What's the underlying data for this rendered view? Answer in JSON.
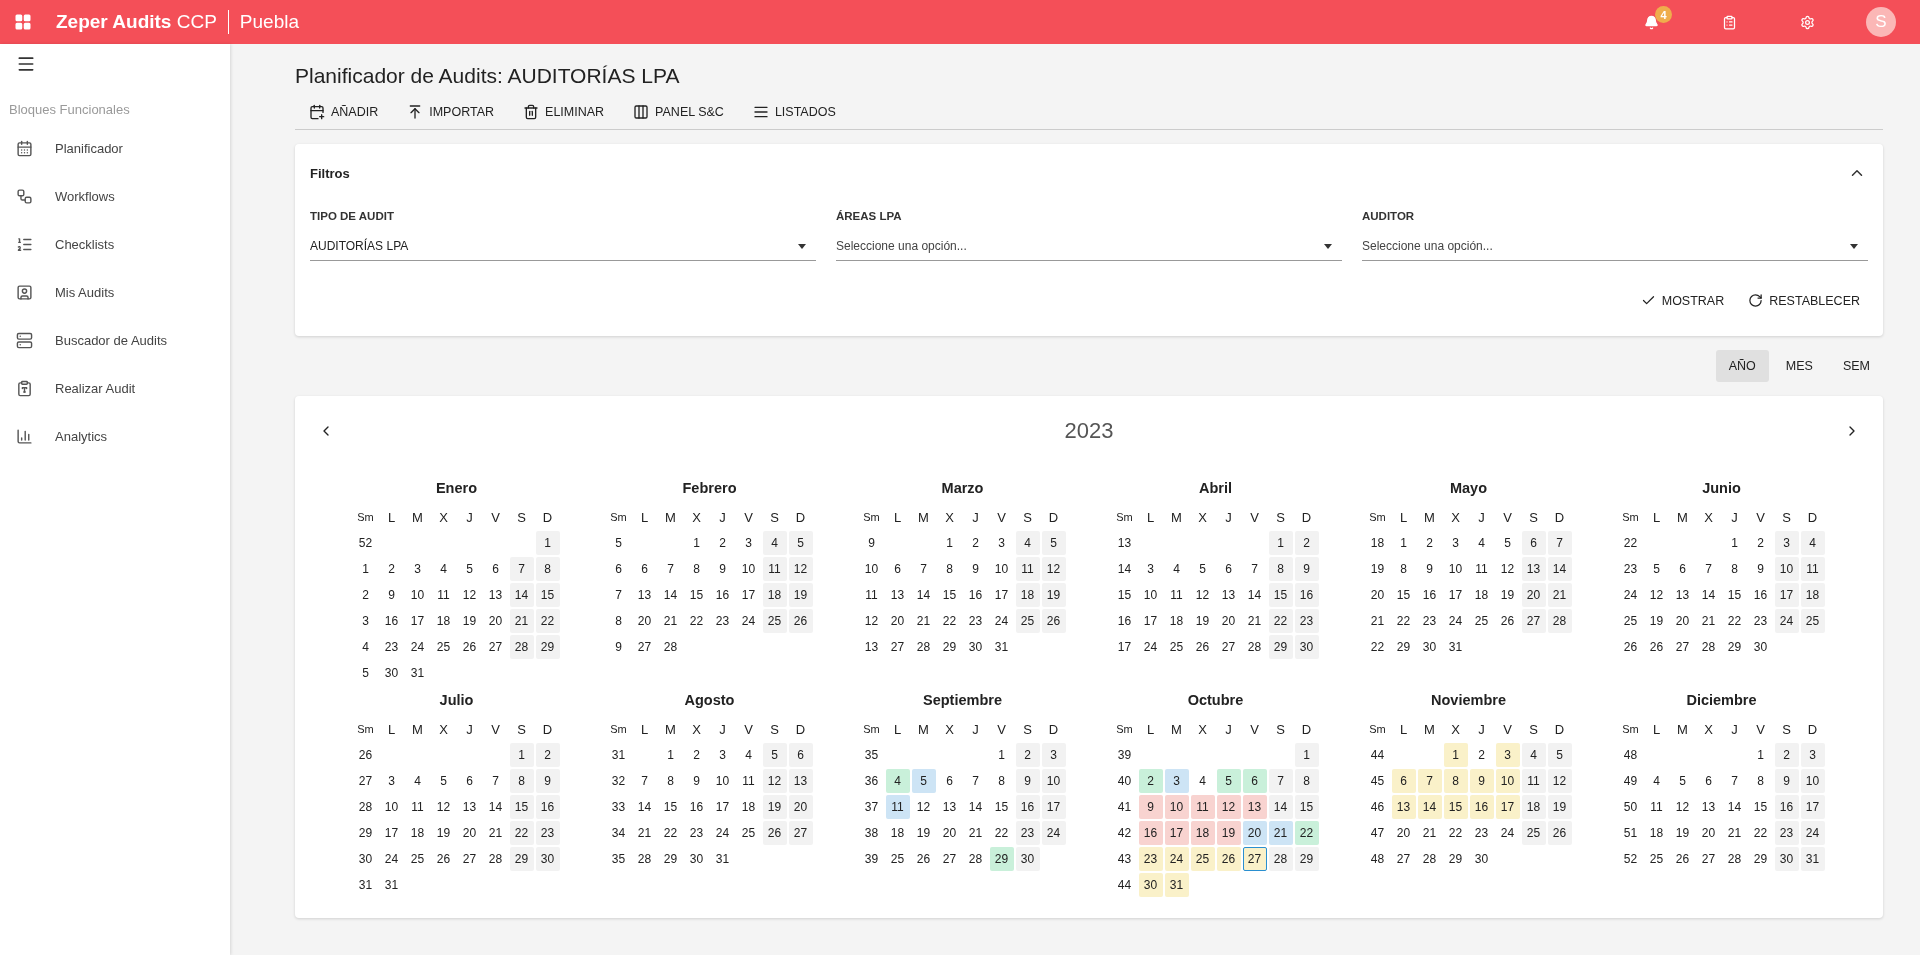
{
  "topbar": {
    "brand_bold": "Zeper Audits",
    "brand_light": "CCP",
    "site": "Puebla",
    "notifications": "4",
    "avatar": "S"
  },
  "sidebar": {
    "section": "Bloques Funcionales",
    "items": [
      {
        "label": "Planificador",
        "kind": "calendar"
      },
      {
        "label": "Workflows",
        "kind": "workflow"
      },
      {
        "label": "Checklists",
        "kind": "checklist"
      },
      {
        "label": "Mis Audits",
        "kind": "user"
      },
      {
        "label": "Buscador de Audits",
        "kind": "stack"
      },
      {
        "label": "Realizar Audit",
        "kind": "clipboard"
      },
      {
        "label": "Analytics",
        "kind": "chart"
      }
    ]
  },
  "page": {
    "title": "Planificador de Audits: AUDITORÍAS LPA",
    "actions": [
      {
        "label": "AÑADIR",
        "kind": "add"
      },
      {
        "label": "IMPORTAR",
        "kind": "import"
      },
      {
        "label": "ELIMINAR",
        "kind": "delete"
      },
      {
        "label": "PANEL S&C",
        "kind": "panel"
      },
      {
        "label": "LISTADOS",
        "kind": "list"
      }
    ]
  },
  "filters": {
    "title": "Filtros",
    "expanded": true,
    "fields": [
      {
        "label": "TIPO DE AUDIT",
        "value": "AUDITORÍAS LPA"
      },
      {
        "label": "ÁREAS LPA",
        "placeholder": "Seleccione una opción..."
      },
      {
        "label": "AUDITOR",
        "placeholder": "Seleccione una opción..."
      }
    ],
    "buttons": [
      {
        "label": "MOSTRAR",
        "kind": "show"
      },
      {
        "label": "RESTABLECER",
        "kind": "reset"
      }
    ]
  },
  "views": [
    {
      "label": "AÑO",
      "selected": true
    },
    {
      "label": "MES",
      "selected": false
    },
    {
      "label": "SEM",
      "selected": false
    }
  ],
  "calendar": {
    "year": "2023",
    "months": [
      {
        "name": "Enero",
        "weekdays": [
          "Sm",
          "L",
          "M",
          "X",
          "J",
          "V",
          "S",
          "D"
        ],
        "weeks": [
          {
            "week": "52",
            "starts_midweek": true,
            "days": [
              "1"
            ]
          },
          {
            "week": "1",
            "days": [
              "2",
              "3",
              "4",
              "5",
              "6",
              "7",
              "8"
            ]
          },
          {
            "week": "2",
            "days": [
              "9",
              "10",
              "11",
              "12",
              "13",
              "14",
              "15"
            ]
          },
          {
            "week": "3",
            "days": [
              "16",
              "17",
              "18",
              "19",
              "20",
              "21",
              "22"
            ]
          },
          {
            "week": "4",
            "days": [
              "23",
              "24",
              "25",
              "26",
              "27",
              "28",
              "29"
            ]
          },
          {
            "week": "5",
            "days": [
              "30",
              "31"
            ]
          }
        ]
      },
      {
        "name": "Febrero",
        "weekdays": [
          "Sm",
          "L",
          "M",
          "X",
          "J",
          "V",
          "S",
          "D"
        ],
        "weeks": [
          {
            "week": "5",
            "starts_midweek": true,
            "days": [
              "1",
              "2",
              "3",
              "4",
              "5"
            ]
          },
          {
            "week": "6",
            "days": [
              "6",
              "7",
              "8",
              "9",
              "10",
              "11",
              "12"
            ]
          },
          {
            "week": "7",
            "days": [
              "13",
              "14",
              "15",
              "16",
              "17",
              "18",
              "19"
            ]
          },
          {
            "week": "8",
            "days": [
              "20",
              "21",
              "22",
              "23",
              "24",
              "25",
              "26"
            ]
          },
          {
            "week": "9",
            "days": [
              "27",
              "28"
            ]
          }
        ]
      },
      {
        "name": "Marzo",
        "weekdays": [
          "Sm",
          "L",
          "M",
          "X",
          "J",
          "V",
          "S",
          "D"
        ],
        "weeks": [
          {
            "week": "9",
            "starts_midweek": true,
            "days": [
              "1",
              "2",
              "3",
              "4",
              "5"
            ]
          },
          {
            "week": "10",
            "days": [
              "6",
              "7",
              "8",
              "9",
              "10",
              "11",
              "12"
            ]
          },
          {
            "week": "11",
            "days": [
              "13",
              "14",
              "15",
              "16",
              "17",
              "18",
              "19"
            ]
          },
          {
            "week": "12",
            "days": [
              "20",
              "21",
              "22",
              "23",
              "24",
              "25",
              "26"
            ]
          },
          {
            "week": "13",
            "days": [
              "27",
              "28",
              "29",
              "30",
              "31"
            ]
          }
        ]
      },
      {
        "name": "Abril",
        "weekdays": [
          "Sm",
          "L",
          "M",
          "X",
          "J",
          "V",
          "S",
          "D"
        ],
        "weeks": [
          {
            "week": "13",
            "starts_midweek": true,
            "days": [
              "1",
              "2"
            ]
          },
          {
            "week": "14",
            "days": [
              "3",
              "4",
              "5",
              "6",
              "7",
              "8",
              "9"
            ]
          },
          {
            "week": "15",
            "days": [
              "10",
              "11",
              "12",
              "13",
              "14",
              "15",
              "16"
            ]
          },
          {
            "week": "16",
            "days": [
              "17",
              "18",
              "19",
              "20",
              "21",
              "22",
              "23"
            ]
          },
          {
            "week": "17",
            "days": [
              "24",
              "25",
              "26",
              "27",
              "28",
              "29",
              "30"
            ]
          }
        ]
      },
      {
        "name": "Mayo",
        "weekdays": [
          "Sm",
          "L",
          "M",
          "X",
          "J",
          "V",
          "S",
          "D"
        ],
        "weeks": [
          {
            "week": "18",
            "days": [
              "1",
              "2",
              "3",
              "4",
              "5",
              "6",
              "7"
            ]
          },
          {
            "week": "19",
            "days": [
              "8",
              "9",
              "10",
              "11",
              "12",
              "13",
              "14"
            ]
          },
          {
            "week": "20",
            "days": [
              "15",
              "16",
              "17",
              "18",
              "19",
              "20",
              "21"
            ]
          },
          {
            "week": "21",
            "days": [
              "22",
              "23",
              "24",
              "25",
              "26",
              "27",
              "28"
            ]
          },
          {
            "week": "22",
            "days": [
              "29",
              "30",
              "31"
            ]
          }
        ]
      },
      {
        "name": "Junio",
        "weekdays": [
          "Sm",
          "L",
          "M",
          "X",
          "J",
          "V",
          "S",
          "D"
        ],
        "weeks": [
          {
            "week": "22",
            "starts_midweek": true,
            "days": [
              "1",
              "2",
              "3",
              "4"
            ]
          },
          {
            "week": "23",
            "days": [
              "5",
              "6",
              "7",
              "8",
              "9",
              "10",
              "11"
            ]
          },
          {
            "week": "24",
            "days": [
              "12",
              "13",
              "14",
              "15",
              "16",
              "17",
              "18"
            ]
          },
          {
            "week": "25",
            "days": [
              "19",
              "20",
              "21",
              "22",
              "23",
              "24",
              "25"
            ]
          },
          {
            "week": "26",
            "days": [
              "26",
              "27",
              "28",
              "29",
              "30"
            ]
          }
        ]
      },
      {
        "name": "Julio",
        "weekdays": [
          "Sm",
          "L",
          "M",
          "X",
          "J",
          "V",
          "S",
          "D"
        ],
        "weeks": [
          {
            "week": "26",
            "starts_midweek": true,
            "days": [
              "1",
              "2"
            ]
          },
          {
            "week": "27",
            "days": [
              "3",
              "4",
              "5",
              "6",
              "7",
              "8",
              "9"
            ]
          },
          {
            "week": "28",
            "days": [
              "10",
              "11",
              "12",
              "13",
              "14",
              "15",
              "16"
            ]
          },
          {
            "week": "29",
            "days": [
              "17",
              "18",
              "19",
              "20",
              "21",
              "22",
              "23"
            ]
          },
          {
            "week": "30",
            "days": [
              "24",
              "25",
              "26",
              "27",
              "28",
              "29",
              "30"
            ]
          },
          {
            "week": "31",
            "days": [
              "31"
            ]
          }
        ]
      },
      {
        "name": "Agosto",
        "weekdays": [
          "Sm",
          "L",
          "M",
          "X",
          "J",
          "V",
          "S",
          "D"
        ],
        "weeks": [
          {
            "week": "31",
            "starts_midweek": true,
            "days": [
              "1",
              "2",
              "3",
              "4",
              "5",
              "6"
            ]
          },
          {
            "week": "32",
            "days": [
              "7",
              "8",
              "9",
              "10",
              "11",
              "12",
              "13"
            ]
          },
          {
            "week": "33",
            "days": [
              "14",
              "15",
              "16",
              "17",
              "18",
              "19",
              "20"
            ]
          },
          {
            "week": "34",
            "days": [
              "21",
              "22",
              "23",
              "24",
              "25",
              "26",
              "27"
            ]
          },
          {
            "week": "35",
            "days": [
              "28",
              "29",
              "30",
              "31"
            ]
          }
        ]
      },
      {
        "name": "Septiembre",
        "weekdays": [
          "Sm",
          "L",
          "M",
          "X",
          "J",
          "V",
          "S",
          "D"
        ],
        "weeks": [
          {
            "week": "35",
            "starts_midweek": true,
            "days": [
              "1",
              "2",
              "3"
            ]
          },
          {
            "week": "36",
            "days": [
              {
                "day": "4",
                "color": "#c9f0da"
              },
              {
                "day": "5",
                "color": "#cde4f5"
              },
              "6",
              "7",
              "8",
              "9",
              "10"
            ]
          },
          {
            "week": "37",
            "days": [
              {
                "day": "11",
                "color": "#cde4f5"
              },
              "12",
              "13",
              "14",
              "15",
              "16",
              "17"
            ]
          },
          {
            "week": "38",
            "days": [
              "18",
              "19",
              "20",
              "21",
              "22",
              "23",
              "24"
            ]
          },
          {
            "week": "39",
            "days": [
              "25",
              "26",
              "27",
              "28",
              {
                "day": "29",
                "color": "#c9f0da"
              },
              "30"
            ]
          }
        ]
      },
      {
        "name": "Octubre",
        "weekdays": [
          "Sm",
          "L",
          "M",
          "X",
          "J",
          "V",
          "S",
          "D"
        ],
        "weeks": [
          {
            "week": "39",
            "starts_midweek": true,
            "days": [
              "1"
            ]
          },
          {
            "week": "40",
            "days": [
              {
                "day": "2",
                "color": "#c9f0da"
              },
              {
                "day": "3",
                "color": "#cde4f5"
              },
              "4",
              {
                "day": "5",
                "color": "#c9f0da"
              },
              {
                "day": "6",
                "color": "#c9f0da"
              },
              "7",
              "8"
            ]
          },
          {
            "week": "41",
            "days": [
              {
                "day": "9",
                "color": "#f8d3d0"
              },
              {
                "day": "10",
                "color": "#f8d3d0"
              },
              {
                "day": "11",
                "color": "#f8d3d0"
              },
              {
                "day": "12",
                "color": "#f8d3d0"
              },
              {
                "day": "13",
                "color": "#f8d3d0"
              },
              "14",
              "15"
            ]
          },
          {
            "week": "42",
            "days": [
              {
                "day": "16",
                "color": "#f8d3d0"
              },
              {
                "day": "17",
                "color": "#f8d3d0"
              },
              {
                "day": "18",
                "color": "#f8d3d0"
              },
              {
                "day": "19",
                "color": "#f8d3d0"
              },
              {
                "day": "20",
                "color": "#cde4f5"
              },
              {
                "day": "21",
                "color": "#cde4f5"
              },
              {
                "day": "22",
                "color": "#c9f0da"
              }
            ]
          },
          {
            "week": "43",
            "days": [
              {
                "day": "23",
                "color": "#faf1c9"
              },
              {
                "day": "24",
                "color": "#faf1c9"
              },
              {
                "day": "25",
                "color": "#faf1c9"
              },
              {
                "day": "26",
                "color": "#faf1c9"
              },
              {
                "day": "27",
                "color": "#faf1c9",
                "today": true
              },
              "28",
              "29"
            ]
          },
          {
            "week": "44",
            "days": [
              {
                "day": "30",
                "color": "#faf1c9"
              },
              {
                "day": "31",
                "color": "#faf1c9"
              }
            ]
          }
        ]
      },
      {
        "name": "Noviembre",
        "weekdays": [
          "Sm",
          "L",
          "M",
          "X",
          "J",
          "V",
          "S",
          "D"
        ],
        "weeks": [
          {
            "week": "44",
            "starts_midweek": true,
            "days": [
              {
                "day": "1",
                "color": "#faf1c9"
              },
              "2",
              {
                "day": "3",
                "color": "#faf1c9"
              },
              "4",
              "5"
            ]
          },
          {
            "week": "45",
            "days": [
              {
                "day": "6",
                "color": "#faf1c9"
              },
              {
                "day": "7",
                "color": "#faf1c9"
              },
              {
                "day": "8",
                "color": "#faf1c9"
              },
              {
                "day": "9",
                "color": "#faf1c9"
              },
              {
                "day": "10",
                "color": "#faf1c9"
              },
              "11",
              "12"
            ]
          },
          {
            "week": "46",
            "days": [
              {
                "day": "13",
                "color": "#faf1c9"
              },
              {
                "day": "14",
                "color": "#faf1c9"
              },
              {
                "day": "15",
                "color": "#faf1c9"
              },
              {
                "day": "16",
                "color": "#faf1c9"
              },
              {
                "day": "17",
                "color": "#faf1c9"
              },
              "18",
              "19"
            ]
          },
          {
            "week": "47",
            "days": [
              "20",
              "21",
              "22",
              "23",
              "24",
              "25",
              "26"
            ]
          },
          {
            "week": "48",
            "days": [
              "27",
              "28",
              "29",
              "30"
            ]
          }
        ]
      },
      {
        "name": "Diciembre",
        "weekdays": [
          "Sm",
          "L",
          "M",
          "X",
          "J",
          "V",
          "S",
          "D"
        ],
        "weeks": [
          {
            "week": "48",
            "starts_midweek": true,
            "days": [
              "1",
              "2",
              "3"
            ]
          },
          {
            "week": "49",
            "days": [
              "4",
              "5",
              "6",
              "7",
              "8",
              "9",
              "10"
            ]
          },
          {
            "week": "50",
            "days": [
              "11",
              "12",
              "13",
              "14",
              "15",
              "16",
              "17"
            ]
          },
          {
            "week": "51",
            "days": [
              "18",
              "19",
              "20",
              "21",
              "22",
              "23",
              "24"
            ]
          },
          {
            "week": "52",
            "days": [
              "25",
              "26",
              "27",
              "28",
              "29",
              "30",
              "31"
            ]
          }
        ]
      }
    ]
  }
}
